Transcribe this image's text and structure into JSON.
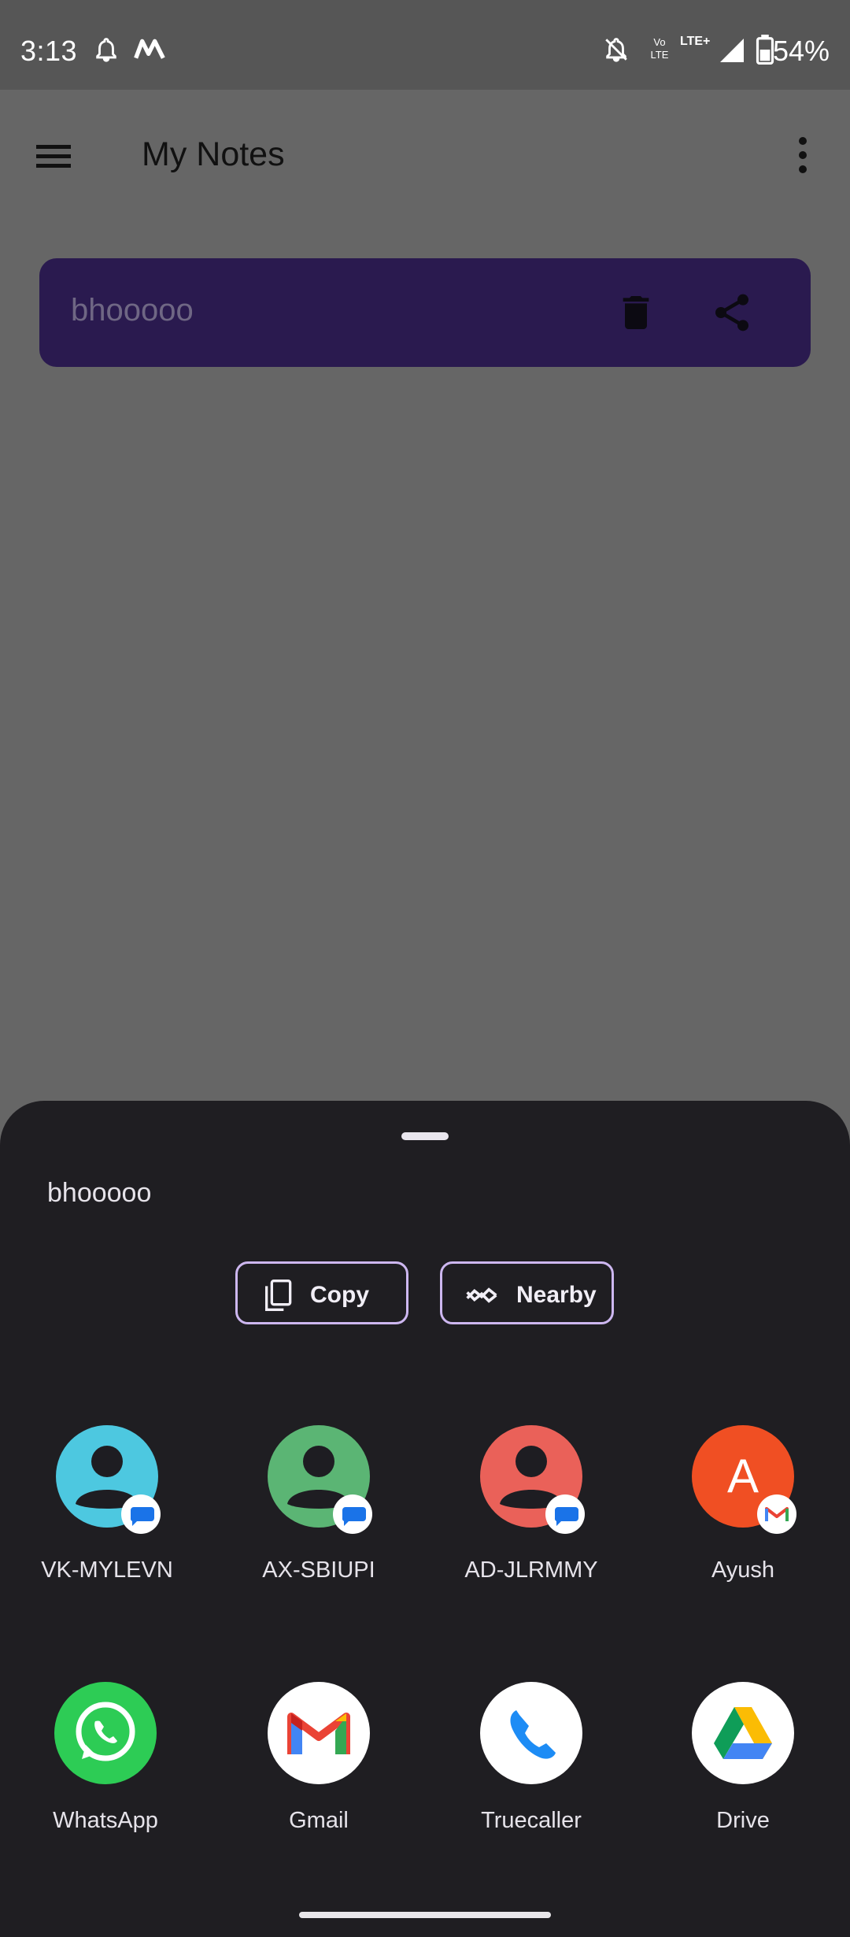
{
  "status_bar": {
    "time": "3:13",
    "battery": "54%",
    "network_label": "LTE+",
    "volte_label": "Vo LTE",
    "icons": [
      "bell-icon",
      "m-app-icon",
      "notifications-off-icon",
      "volte-icon",
      "lte-icon",
      "signal-icon",
      "battery-icon"
    ]
  },
  "app_bar": {
    "title": "My Notes",
    "menu_icon": "hamburger-menu-icon",
    "more_icon": "more-vert-icon"
  },
  "notes": [
    {
      "text": "bhooooo",
      "delete_icon": "trash-icon",
      "share_icon": "share-icon"
    }
  ],
  "colors": {
    "scrim_background": "#666666",
    "note_card": "#2a1a4f",
    "sheet_background": "#1f1e22",
    "chip_border": "#cdb7f0"
  },
  "share_sheet": {
    "preview_text": "bhooooo",
    "actions": [
      {
        "label": "Copy",
        "icon": "copy-icon"
      },
      {
        "label": "Nearby",
        "icon": "nearby-share-icon"
      }
    ],
    "direct_targets": [
      {
        "label": "VK-MYLEVN",
        "avatar_color": "#4dc8e0",
        "badge": "messages-icon"
      },
      {
        "label": "AX-SBIUPI",
        "avatar_color": "#5bb574",
        "badge": "messages-icon"
      },
      {
        "label": "AD-JLRMMY",
        "avatar_color": "#ea6159",
        "badge": "messages-icon"
      },
      {
        "label": "Ayush",
        "avatar_color": "#f04f23",
        "initial": "A",
        "badge": "gmail-icon"
      }
    ],
    "apps": [
      {
        "label": "WhatsApp",
        "icon": "whatsapp-icon"
      },
      {
        "label": "Gmail",
        "icon": "gmail-icon"
      },
      {
        "label": "Truecaller",
        "icon": "truecaller-icon"
      },
      {
        "label": "Drive",
        "icon": "google-drive-icon"
      }
    ]
  }
}
